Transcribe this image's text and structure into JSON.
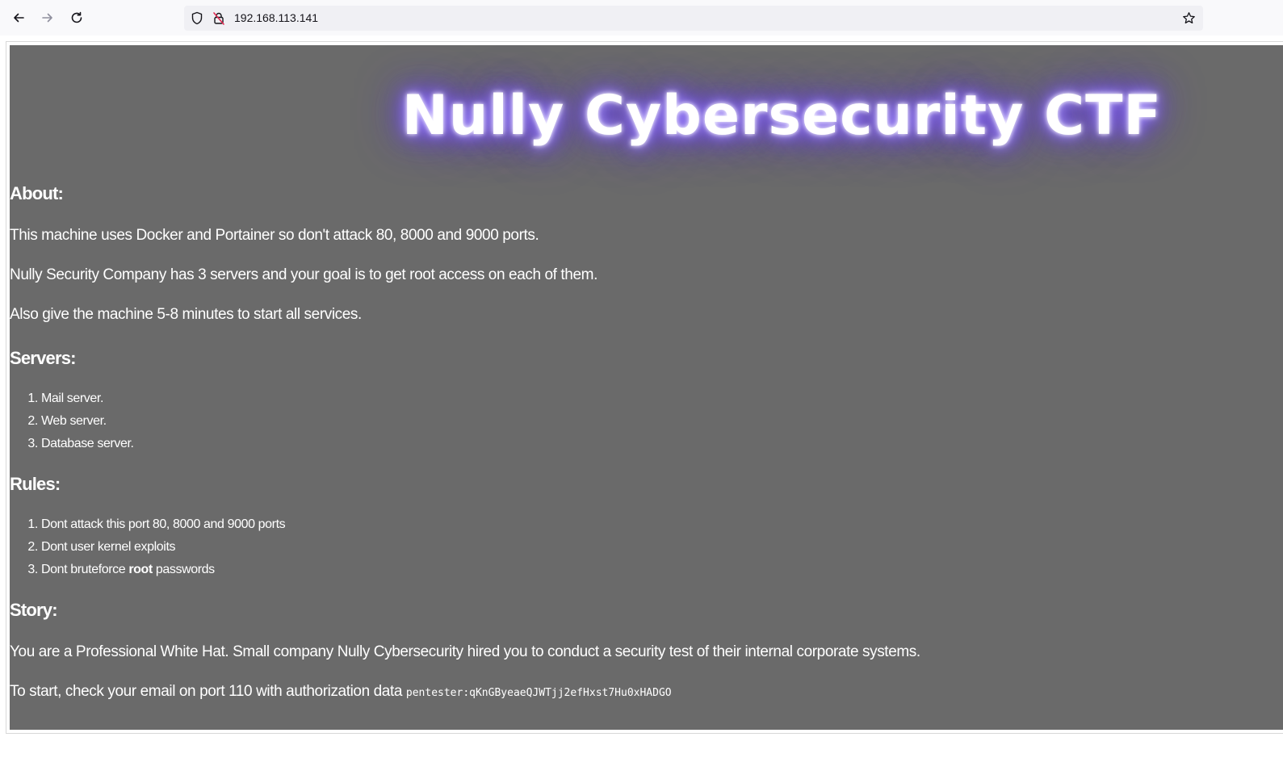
{
  "browser": {
    "url": "192.168.113.141",
    "icons": {
      "back": "arrow-left-icon",
      "forward": "arrow-right-icon",
      "reload": "reload-icon",
      "tracking": "shield-icon",
      "insecure": "lock-slash-icon",
      "bookmark": "star-icon"
    }
  },
  "page": {
    "hero_title": "Nully Cybersecurity CTF",
    "about": {
      "heading": "About:",
      "paragraphs": [
        "This machine uses Docker and Portainer so don't attack 80, 8000 and 9000 ports.",
        "Nully Security Company has 3 servers and your goal is to get root access on each of them.",
        "Also give the machine 5-8 minutes to start all services."
      ]
    },
    "servers": {
      "heading": "Servers:",
      "items": [
        "Mail server.",
        "Web server.",
        "Database server."
      ]
    },
    "rules": {
      "heading": "Rules:",
      "items": [
        "Dont attack this port 80, 8000 and 9000 ports",
        "Dont user kernel exploits"
      ],
      "item3_prefix": "Dont bruteforce ",
      "item3_bold": "root",
      "item3_suffix": " passwords"
    },
    "story": {
      "heading": "Story:",
      "paragraph": "You are a Professional White Hat. Small company Nully Cybersecurity hired you to conduct a security test of their internal corporate systems.",
      "start_text": "To start, check your email on port 110 with authorization data ",
      "credentials": "pentester:qKnGByeaeQJWTjj2efHxst7Hu0xHADGO"
    }
  },
  "colors": {
    "page_background": "#6a6a6a",
    "glow": "#7b5cff",
    "text": "#ffffff"
  }
}
